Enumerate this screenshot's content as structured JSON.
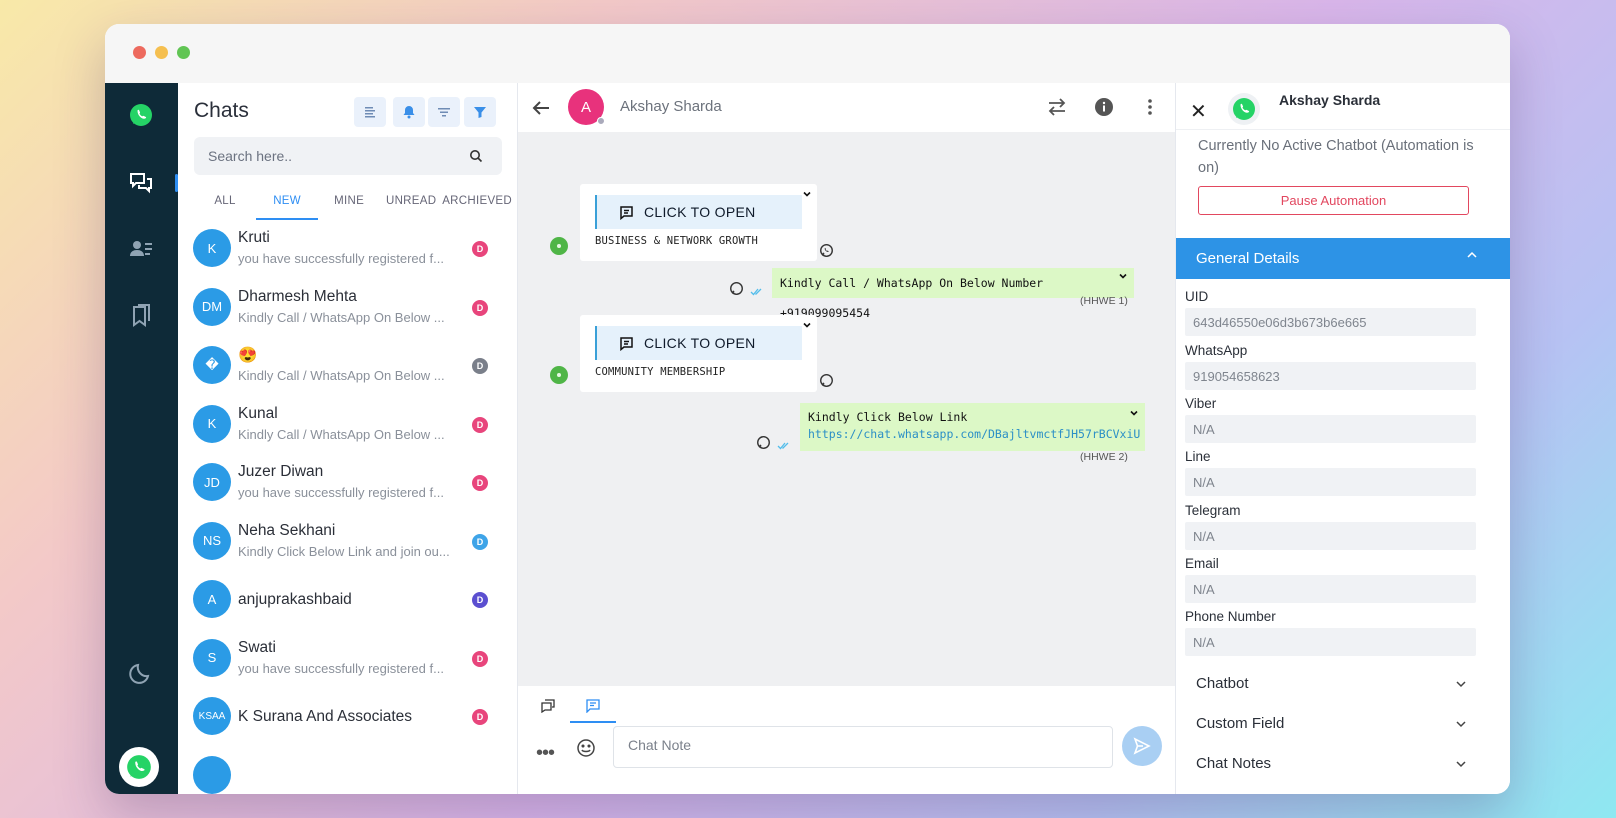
{
  "rail": {
    "items": [
      "whatsapp-icon",
      "chats-icon",
      "contacts-icon",
      "bookmarks-icon"
    ],
    "bottom": [
      "moon-icon",
      "whatsapp-avatar"
    ]
  },
  "chats": {
    "title": "Chats",
    "search_placeholder": "Search here..",
    "tabs": [
      "ALL",
      "NEW",
      "MINE",
      "UNREAD",
      "ARCHIEVED"
    ],
    "active_tab": "NEW",
    "list": [
      {
        "initials": "K",
        "name": "Kruti",
        "preview": "you have successfully registered f...",
        "badge": "D",
        "badge_color": "#e8457c"
      },
      {
        "initials": "DM",
        "name": "Dharmesh Mehta",
        "preview": "Kindly Call / WhatsApp On Below ...",
        "badge": "D",
        "badge_color": "#e8457c"
      },
      {
        "initials": "�",
        "name": "😍",
        "preview": "Kindly Call / WhatsApp On Below ...",
        "badge": "D",
        "badge_color": "#7a7f8a"
      },
      {
        "initials": "K",
        "name": "Kunal",
        "preview": "Kindly Call / WhatsApp On Below ...",
        "badge": "D",
        "badge_color": "#e8457c"
      },
      {
        "initials": "JD",
        "name": "Juzer Diwan",
        "preview": "you have successfully registered f...",
        "badge": "D",
        "badge_color": "#e8457c"
      },
      {
        "initials": "NS",
        "name": "Neha Sekhani",
        "preview": "Kindly Click Below Link and join ou...",
        "badge": "D",
        "badge_color": "#3ea4e8"
      },
      {
        "initials": "A",
        "name": "anjuprakashbaid",
        "preview": "",
        "badge": "D",
        "badge_color": "#5b4fd0"
      },
      {
        "initials": "S",
        "name": "Swati",
        "preview": "you have successfully registered f...",
        "badge": "D",
        "badge_color": "#e8457c"
      },
      {
        "initials": "KSAA",
        "name": "K Surana And Associates",
        "preview": "",
        "badge": "D",
        "badge_color": "#e8457c"
      },
      {
        "initials": "",
        "name": "",
        "preview": "",
        "badge": "",
        "badge_color": "#3ea4e8"
      }
    ]
  },
  "conversation": {
    "contact_name": "Akshay Sharda",
    "contact_initial": "A",
    "messages": {
      "m1_button": "CLICK TO OPEN",
      "m1_body": "BUSINESS & NETWORK GROWTH",
      "m2_text": "Kindly Call / WhatsApp On Below Number +919099095454",
      "m2_tag": "(HHWE 1)",
      "m3_button": "CLICK TO OPEN",
      "m3_body": "COMMUNITY MEMBERSHIP",
      "m4_text": "Kindly Click Below Link",
      "m4_link": "https://chat.whatsapp.com/DBajltvmctfJH57rBCVxiU",
      "m4_tag": "(HHWE 2)"
    },
    "composer": {
      "placeholder": "Chat Note",
      "more": "•••"
    }
  },
  "panel": {
    "close": "✕",
    "name": "Akshay Sharda",
    "bot_status": "Currently No Active Chatbot (Automation is on)",
    "pause_label": "Pause Automation",
    "general_title": "General Details",
    "fields": [
      {
        "label": "UID",
        "value": "643d46550e06d3b673b6e665"
      },
      {
        "label": "WhatsApp",
        "value": "919054658623"
      },
      {
        "label": "Viber",
        "value": "N/A"
      },
      {
        "label": "Line",
        "value": "N/A"
      },
      {
        "label": "Telegram",
        "value": "N/A"
      },
      {
        "label": "Email",
        "value": "N/A"
      },
      {
        "label": "Phone Number",
        "value": "N/A"
      }
    ],
    "sections": [
      "Chatbot",
      "Custom Field",
      "Chat Notes"
    ]
  },
  "colors": {
    "accent": "#2e8ef3",
    "rail": "#0e2a38",
    "outgoing_bubble": "#dcf8c6",
    "whatsapp_green": "#25d366"
  }
}
